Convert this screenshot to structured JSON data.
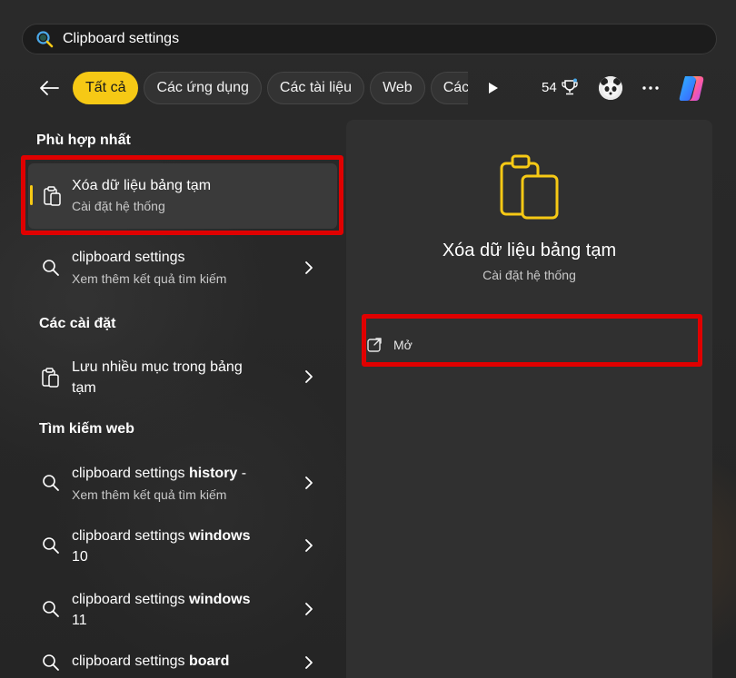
{
  "search": {
    "value": "Clipboard settings",
    "icon": "search-icon"
  },
  "filters": {
    "back_icon": "arrow-left-icon",
    "chips": [
      {
        "label": "Tất cả",
        "active": true
      },
      {
        "label": "Các ứng dụng",
        "active": false
      },
      {
        "label": "Các tài liệu",
        "active": false
      },
      {
        "label": "Web",
        "active": false
      },
      {
        "label": "Các c",
        "active": false
      }
    ],
    "points": "54",
    "points_icon": "trophy-icon",
    "more_icon": "more-horizontal-icon",
    "accent_color": "#f6c915"
  },
  "best_match": {
    "heading": "Phù hợp nhất",
    "title": "Xóa dữ liệu bảng tạm",
    "subtitle": "Cài đặt hệ thống",
    "icon": "clipboard-icon"
  },
  "search_more": {
    "title": "clipboard settings",
    "subtitle": "Xem thêm kết quả tìm kiếm"
  },
  "settings_section": {
    "heading": "Các cài đặt",
    "items": [
      {
        "line1": "Lưu nhiều mục trong bảng",
        "line2": "tạm",
        "icon": "clipboard-icon"
      }
    ]
  },
  "web_section": {
    "heading": "Tìm kiếm web",
    "items": [
      {
        "prefix": "clipboard settings ",
        "bold": "history",
        "suffix": " -",
        "line2": "Xem thêm kết quả tìm kiếm"
      },
      {
        "prefix": "clipboard settings ",
        "bold": "windows",
        "suffix": "",
        "line2": "10"
      },
      {
        "prefix": "clipboard settings ",
        "bold": "windows",
        "suffix": "",
        "line2": "11"
      },
      {
        "prefix": "clipboard settings ",
        "bold": "board",
        "suffix": "",
        "line2": ""
      }
    ]
  },
  "detail": {
    "title": "Xóa dữ liệu bảng tạm",
    "subtitle": "Cài đặt hệ thống",
    "icon": "clipboard-icon",
    "open_label": "Mở",
    "open_icon": "open-external-icon"
  },
  "highlight_color": "#e00000"
}
